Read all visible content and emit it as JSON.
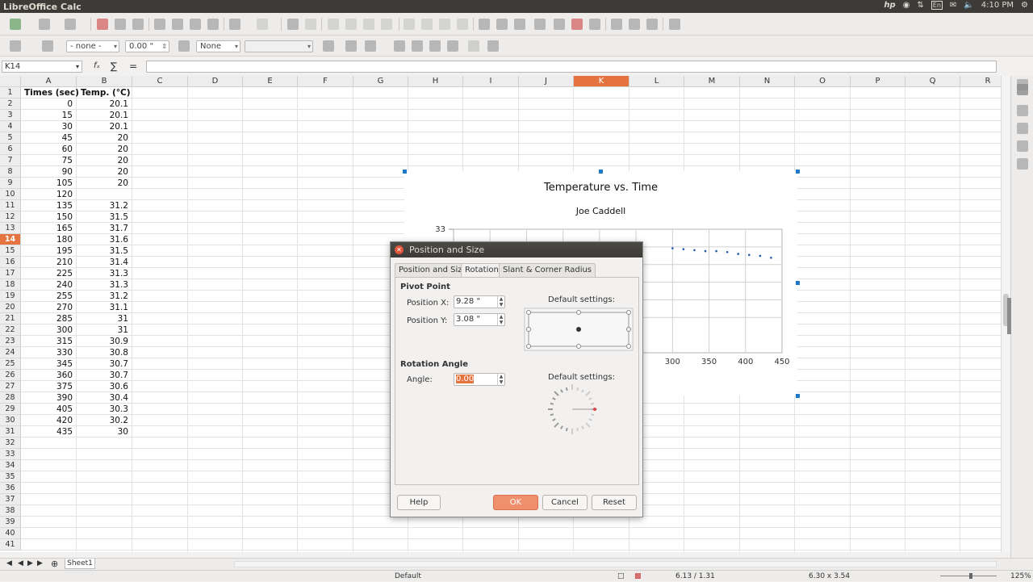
{
  "window": {
    "title": "LibreOffice Calc"
  },
  "tray": {
    "keyboard": "En",
    "time": "4:10 PM"
  },
  "format_toolbar": {
    "line_style": "- none -",
    "line_width": "0.00 \"",
    "area_fill": "None"
  },
  "formula_bar": {
    "name_box": "K14",
    "fx_label": "fₓ",
    "sum_label": "∑",
    "equals_label": "=",
    "content": ""
  },
  "columns": [
    "A",
    "B",
    "C",
    "D",
    "E",
    "F",
    "G",
    "H",
    "I",
    "J",
    "K",
    "L",
    "M",
    "N",
    "O",
    "P",
    "Q",
    "R"
  ],
  "selected_column": "K",
  "selected_row": 14,
  "rows": [
    1,
    2,
    3,
    4,
    5,
    6,
    7,
    8,
    9,
    10,
    11,
    12,
    13,
    14,
    15,
    16,
    17,
    18,
    19,
    20,
    21,
    22,
    23,
    24,
    25,
    26,
    27,
    28,
    29,
    30,
    31,
    32,
    33,
    34,
    35,
    36,
    37,
    38,
    39,
    40,
    41
  ],
  "sheet_headers": {
    "a1": "Times (sec)",
    "b1": "Temp. (°C)"
  },
  "table_data": [
    [
      "0",
      "20.1"
    ],
    [
      "15",
      "20.1"
    ],
    [
      "30",
      "20.1"
    ],
    [
      "45",
      "20"
    ],
    [
      "60",
      "20"
    ],
    [
      "75",
      "20"
    ],
    [
      "90",
      "20"
    ],
    [
      "105",
      "20"
    ],
    [
      "120",
      ""
    ],
    [
      "135",
      "31.2"
    ],
    [
      "150",
      "31.5"
    ],
    [
      "165",
      "31.7"
    ],
    [
      "180",
      "31.6"
    ],
    [
      "195",
      "31.5"
    ],
    [
      "210",
      "31.4"
    ],
    [
      "225",
      "31.3"
    ],
    [
      "240",
      "31.3"
    ],
    [
      "255",
      "31.2"
    ],
    [
      "270",
      "31.1"
    ],
    [
      "285",
      "31"
    ],
    [
      "300",
      "31"
    ],
    [
      "315",
      "30.9"
    ],
    [
      "330",
      "30.8"
    ],
    [
      "345",
      "30.7"
    ],
    [
      "360",
      "30.7"
    ],
    [
      "375",
      "30.6"
    ],
    [
      "390",
      "30.4"
    ],
    [
      "405",
      "30.3"
    ],
    [
      "420",
      "30.2"
    ],
    [
      "435",
      "30"
    ]
  ],
  "chart_data": {
    "type": "scatter",
    "title": "Temperature vs. Time",
    "subtitle": "Joe Caddell",
    "x_ticks": [
      "300",
      "350",
      "400",
      "450"
    ],
    "y_ticks": [
      "33"
    ],
    "series": [
      {
        "x": [
          300,
          315,
          330,
          345,
          360,
          375,
          390,
          405,
          420,
          435
        ],
        "y": [
          31,
          30.9,
          30.8,
          30.7,
          30.7,
          30.6,
          30.4,
          30.3,
          30.2,
          30
        ]
      }
    ],
    "series_color": "#1e5aa8"
  },
  "dialog": {
    "title": "Position and Size",
    "tabs": [
      "Position and Size",
      "Rotation",
      "Slant & Corner Radius"
    ],
    "active_tab": "Rotation",
    "pivot_section": "Pivot Point",
    "pos_x_label": "Position X:",
    "pos_x_value": "9.28 \"",
    "pos_y_label": "Position Y:",
    "pos_y_value": "3.08 \"",
    "default_settings_1": "Default settings:",
    "rotation_section": "Rotation Angle",
    "angle_label": "Angle:",
    "angle_value": "0.00",
    "default_settings_2": "Default settings:",
    "buttons": {
      "help": "Help",
      "ok": "OK",
      "cancel": "Cancel",
      "reset": "Reset"
    }
  },
  "sheet_tab": "Sheet1",
  "statusbar": {
    "page_style": "Default",
    "position": "6.13 / 1.31",
    "size": "6.30 x 3.54",
    "zoom": "125%"
  }
}
